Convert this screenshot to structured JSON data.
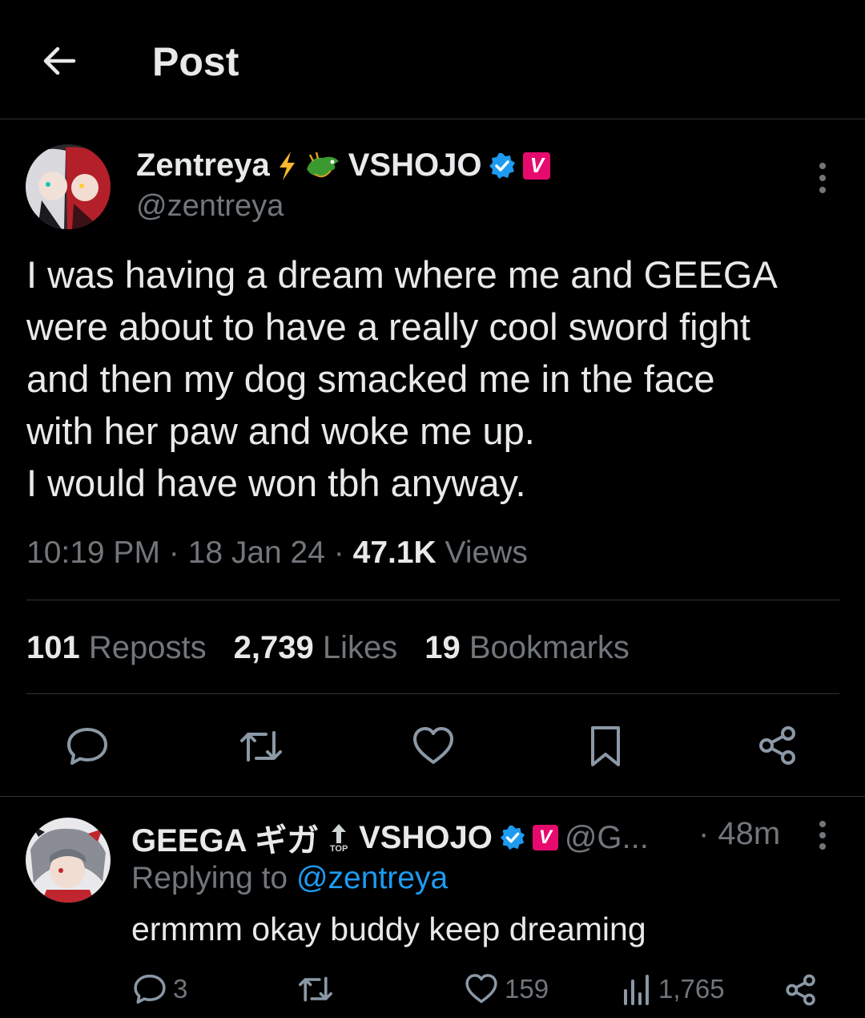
{
  "header": {
    "title": "Post",
    "back_icon": "arrow-left-icon"
  },
  "colors": {
    "background": "#000000",
    "text": "#e7e9ea",
    "muted": "#71767b",
    "link": "#1d9bf0",
    "verified": "#1d9bf0",
    "vshojo_badge": "#e60a6e"
  },
  "post": {
    "author": {
      "name": "Zentreya",
      "affiliation": "VSHOJO",
      "handle": "@zentreya",
      "badge_letter": "V",
      "emoji_icons": [
        "lightning-icon",
        "dragon-icon"
      ]
    },
    "text_lines": [
      "I was having a dream where me and GEEGA",
      "were about to have a really cool sword fight",
      "and then my dog smacked me in the face",
      "with her paw and woke me up.",
      "I would have won tbh anyway."
    ],
    "time": "10:19 PM",
    "date": "18 Jan 24",
    "views_count": "47.1K",
    "views_label": "Views",
    "separator": "·",
    "stats": {
      "reposts": "101",
      "reposts_label": "Reposts",
      "likes": "2,739",
      "likes_label": "Likes",
      "bookmarks": "19",
      "bookmarks_label": "Bookmarks"
    }
  },
  "reply": {
    "author": {
      "name": "GEEGA ギガ",
      "top_label": "TOP",
      "affiliation": "VSHOJO",
      "handle": "@G...",
      "badge_letter": "V"
    },
    "time": "· 48m",
    "replying_prefix": "Replying to",
    "replying_handle": "@zentreya",
    "text": "ermmm okay buddy keep dreaming",
    "actions": {
      "replies": "3",
      "likes": "159",
      "views": "1,765"
    }
  }
}
